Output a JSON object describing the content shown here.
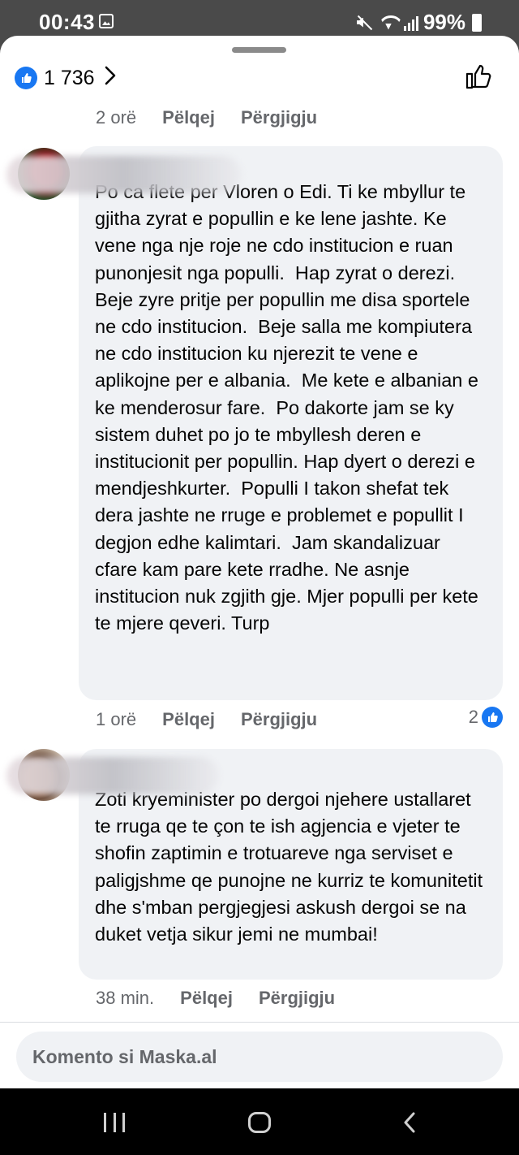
{
  "status_bar": {
    "time": "00:43",
    "battery": "99%"
  },
  "header": {
    "reaction_count": "1 736"
  },
  "comments": [
    {
      "time": "2 orë",
      "like_label": "Pëlqej",
      "reply_label": "Përgjigju"
    },
    {
      "text": "Po ca flete per Vloren o Edi. Ti ke mbyllur te gjitha zyrat e popullin e ke lene jashte. Ke vene nga nje roje ne cdo institucion e ruan punonjesit nga populli.  Hap zyrat o derezi.  Beje zyre pritje per popullin me disa sportele ne cdo institucion.  Beje salla me kompiutera ne cdo institucion ku njerezit te vene e aplikojne per e albania.  Me kete e albanian e ke menderosur fare.  Po dakorte jam se ky sistem duhet po jo te mbyllesh deren e institucionit per popullin. Hap dyert o derezi e mendjeshkurter.  Populli I takon shefat tek dera jashte ne rruge e problemet e popullit I degjon edhe kalimtari.  Jam skandalizuar cfare kam pare kete rradhe. Ne asnje institucion nuk zgjith gje. Mjer populli per kete te mjere qeveri. Turp",
      "time": "1 orë",
      "like_label": "Pëlqej",
      "reply_label": "Përgjigju",
      "reaction_count": "2"
    },
    {
      "text": "Zoti kryeminister po dergoi njehere ustallaret te rruga qe te çon te ish agjencia e vjeter te shofin zaptimin e trotuareve nga serviset e paligjshme qe punojne ne kurriz te komunitetit dhe s'mban pergjegjesi askush dergoi se na duket vetja sikur jemi ne mumbai!",
      "time": "38 min.",
      "like_label": "Pëlqej",
      "reply_label": "Përgjigju"
    }
  ],
  "composer": {
    "placeholder": "Komento si Maska.al"
  },
  "colors": {
    "accent": "#1877f2",
    "bubble": "#f0f2f5",
    "meta": "#65676b"
  },
  "icons": [
    "like-badge-icon",
    "chevron-right-icon",
    "thumbs-up-outline-icon",
    "recent-apps-icon",
    "home-icon",
    "back-icon"
  ]
}
